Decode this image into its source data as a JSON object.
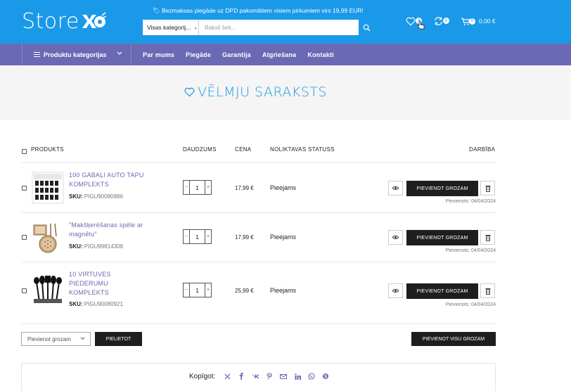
{
  "header": {
    "logo_text": "Store",
    "promo": "🏷 Bezmaksas piegāde uz DPD pakomātiem visiem pirkumiem virs 19,99 EUR!",
    "search_category": "Visas kategorij...",
    "search_placeholder": "Rakstī šeit...",
    "wishlist_count": "3",
    "compare_count": "0",
    "cart_count": "0",
    "cart_total": "0,00 €"
  },
  "nav": {
    "categories_label": "Produktu kategorijas",
    "links": [
      "Par mums",
      "Piegāde",
      "Garantija",
      "Atgriešana",
      "Kontakti"
    ]
  },
  "page_title": "VĒLMJU SARAKSTS",
  "table": {
    "headers": {
      "product": "PRODUKTS",
      "qty": "DAUDZUMS",
      "price": "CENA",
      "stock": "NOLIKTAVAS STATUSS",
      "action": "DARBĪBA"
    },
    "rows": [
      {
        "name_line1": "100 GABALI AUTO TAPU",
        "name_line2": "KOMPLEKTS",
        "name_line3": "",
        "sku_label": "SKU:",
        "sku": "PIGU90080886",
        "qty": "1",
        "price": "17,99 €",
        "stock": "Pieejams",
        "add_label": "PIEVIENOT GROZAM",
        "added": "Pievienots: 04/04/2024"
      },
      {
        "name_line1": "\"Makšķerēšanas spēle ar",
        "name_line2": "magnētu\"",
        "name_line3": "",
        "sku_label": "SKU:",
        "sku": "PIGU99814308",
        "qty": "1",
        "price": "17,99 €",
        "stock": "Pieejams",
        "add_label": "PIEVIENOT GROZAM",
        "added": "Pievienots: 04/04/2024"
      },
      {
        "name_line1": "10 VIRTUVES",
        "name_line2": "PIEDERUMU",
        "name_line3": "KOMPLEKTS",
        "sku_label": "SKU:",
        "sku": "PIGU90080921",
        "qty": "1",
        "price": "25,99 €",
        "stock": "Pieejams",
        "add_label": "PIEVIENOT GROZAM",
        "added": "Pievienots: 04/04/2024"
      }
    ]
  },
  "bulk": {
    "select_value": "Pievienot grozam",
    "apply_label": "PIELIETOT",
    "add_all_label": "PIEVIENOT VISU GROZAM"
  },
  "share": {
    "label": "Kopīgot:",
    "icons": [
      "x-icon",
      "facebook-icon",
      "vk-icon",
      "pinterest-icon",
      "email-icon",
      "linkedin-icon",
      "whatsapp-icon",
      "skype-icon"
    ]
  },
  "colors": {
    "header": "#1a99e8",
    "nav": "#6b69b3",
    "link": "#6b69b3",
    "button": "#1e1e1e"
  }
}
